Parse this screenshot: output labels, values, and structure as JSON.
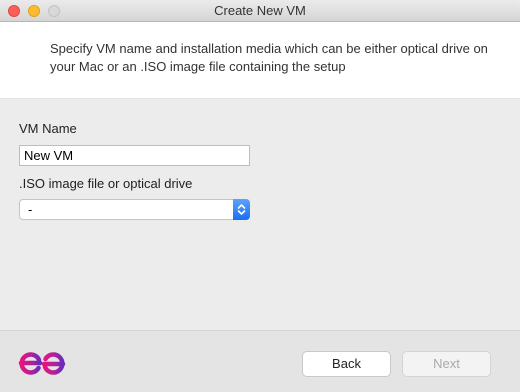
{
  "window": {
    "title": "Create New VM"
  },
  "header": {
    "description": "Specify VM name and installation media which can be either optical drive on your Mac or an .ISO image file containing the setup"
  },
  "form": {
    "vm_name_label": "VM Name",
    "vm_name_value": "New VM",
    "iso_label": ".ISO image file or optical drive",
    "iso_selected": "-"
  },
  "footer": {
    "logo_icon": "eltima-ee-logo-icon",
    "back_label": "Back",
    "next_label": "Next"
  },
  "colors": {
    "select_accent": "#1a6ff1",
    "logo_pink": "#e4157c",
    "logo_purple": "#6a2bbd"
  }
}
